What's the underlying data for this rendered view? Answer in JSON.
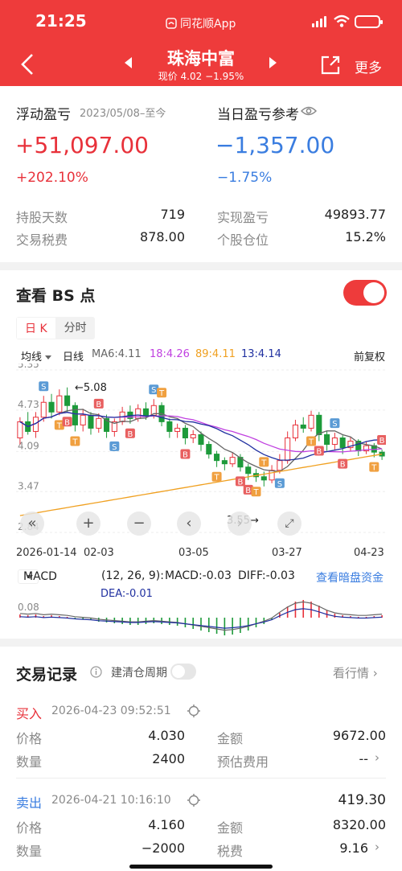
{
  "status": {
    "time": "21:25",
    "app": "同花顺App"
  },
  "header": {
    "title": "珠海中富",
    "subtitle": "现价 4.02 −1.95%",
    "more": "更多"
  },
  "summary": {
    "float_label": "浮动盈亏",
    "float_period": "2023/05/08–至今",
    "float_value": "+51,097.00",
    "float_pct": "+202.10%",
    "day_label": "当日盈亏参考",
    "day_value": "−1,357.00",
    "day_pct": "−1.75%",
    "rows": [
      {
        "label": "持股天数",
        "value": "719",
        "label2": "实现盈亏",
        "value2": "49893.77"
      },
      {
        "label": "交易税费",
        "value": "878.00",
        "label2": "个股仓位",
        "value2": "15.2%"
      }
    ]
  },
  "bs": {
    "title": "查看 BS 点",
    "tabs": [
      "日 K",
      "分时"
    ],
    "indicator": "均线",
    "period": "日线",
    "ma": [
      {
        "label": "MA6:4.11",
        "color": "#666666"
      },
      {
        "label": "18:4.26",
        "color": "#c040e0"
      },
      {
        "label": "89:4.11",
        "color": "#f0a020"
      },
      {
        "label": "13:4.14",
        "color": "#2030a0"
      }
    ],
    "adjust": "前复权",
    "y_labels": [
      "5.35",
      "4.73",
      "4.09",
      "3.47",
      "2.84"
    ],
    "high_note": "←5.08",
    "low_note": "3.55→",
    "dates": [
      "2026-01-14",
      "02-03",
      "03-05",
      "03-27",
      "04-23"
    ],
    "macd_label": "MACD",
    "macd_params": "(12, 26, 9):",
    "macd_value": "MACD:-0.03",
    "diff_value": "DIFF:-0.03",
    "dea_value": "DEA:-0.01",
    "macd_y": "0.08",
    "dark_link": "查看暗盘资金"
  },
  "records": {
    "title": "交易记录",
    "clear_label": "建清仓周期",
    "view_quote": "看行情",
    "trades": [
      {
        "side": "买入",
        "datetime": "2026-04-23 09:52:51",
        "pnl": "",
        "price_label": "价格",
        "price": "4.030",
        "amount_label": "金额",
        "amount": "9672.00",
        "qty_label": "数量",
        "qty": "2400",
        "fee_label": "预估费用",
        "fee": "--"
      },
      {
        "side": "卖出",
        "datetime": "2026-04-21 10:16:10",
        "pnl": "419.30",
        "price_label": "价格",
        "price": "4.160",
        "amount_label": "金额",
        "amount": "8320.00",
        "qty_label": "数量",
        "qty": "−2000",
        "fee_label": "税费",
        "fee": "9.16"
      }
    ]
  },
  "chart_data": {
    "type": "candlestick",
    "title": "",
    "ylim": [
      2.84,
      5.35
    ],
    "x_labels": [
      "2026-01-14",
      "02-03",
      "03-05",
      "03-27",
      "04-23"
    ],
    "candles": [
      [
        4.3,
        4.55,
        4.62,
        4.2
      ],
      [
        4.55,
        4.4,
        4.7,
        4.35
      ],
      [
        4.4,
        4.62,
        4.7,
        4.3
      ],
      [
        4.62,
        4.85,
        4.95,
        4.55
      ],
      [
        4.85,
        4.7,
        4.98,
        4.6
      ],
      [
        4.7,
        4.95,
        5.05,
        4.65
      ],
      [
        4.95,
        4.8,
        5.08,
        4.7
      ],
      [
        4.8,
        4.5,
        4.85,
        4.4
      ],
      [
        4.5,
        4.65,
        4.75,
        4.4
      ],
      [
        4.65,
        4.45,
        4.7,
        4.35
      ],
      [
        4.45,
        4.6,
        4.68,
        4.38
      ],
      [
        4.6,
        4.4,
        4.66,
        4.3
      ],
      [
        4.4,
        4.55,
        4.6,
        4.32
      ],
      [
        4.55,
        4.7,
        4.78,
        4.5
      ],
      [
        4.7,
        4.6,
        4.8,
        4.52
      ],
      [
        4.6,
        4.75,
        4.82,
        4.55
      ],
      [
        4.75,
        4.65,
        4.85,
        4.58
      ],
      [
        4.65,
        4.8,
        4.9,
        4.6
      ],
      [
        4.8,
        4.55,
        4.85,
        4.48
      ],
      [
        4.55,
        4.4,
        4.6,
        4.3
      ],
      [
        4.4,
        4.45,
        4.52,
        4.3
      ],
      [
        4.45,
        4.3,
        4.5,
        4.2
      ],
      [
        4.3,
        4.35,
        4.42,
        4.22
      ],
      [
        4.35,
        4.2,
        4.4,
        4.1
      ],
      [
        4.2,
        4.05,
        4.25,
        3.98
      ],
      [
        4.05,
        3.95,
        4.1,
        3.85
      ],
      [
        3.95,
        3.9,
        4.0,
        3.8
      ],
      [
        3.9,
        4.0,
        4.08,
        3.85
      ],
      [
        4.0,
        3.85,
        4.05,
        3.78
      ],
      [
        3.85,
        3.75,
        3.9,
        3.65
      ],
      [
        3.75,
        3.7,
        3.82,
        3.62
      ],
      [
        3.7,
        3.65,
        3.78,
        3.55
      ],
      [
        3.65,
        3.8,
        3.88,
        3.6
      ],
      [
        3.8,
        3.95,
        4.05,
        3.75
      ],
      [
        3.95,
        4.3,
        4.4,
        3.9
      ],
      [
        4.3,
        4.5,
        4.58,
        4.25
      ],
      [
        4.5,
        4.45,
        4.62,
        4.38
      ],
      [
        4.45,
        4.65,
        4.72,
        4.4
      ],
      [
        4.65,
        4.35,
        4.7,
        4.25
      ],
      [
        4.35,
        4.2,
        4.4,
        4.1
      ],
      [
        4.2,
        4.3,
        4.38,
        4.12
      ],
      [
        4.3,
        4.15,
        4.34,
        4.05
      ],
      [
        4.15,
        4.25,
        4.32,
        4.1
      ],
      [
        4.25,
        4.1,
        4.28,
        4.02
      ],
      [
        4.1,
        4.18,
        4.24,
        4.05
      ],
      [
        4.18,
        4.08,
        4.22,
        4.0
      ],
      [
        4.08,
        4.02,
        4.12,
        3.96
      ]
    ]
  }
}
